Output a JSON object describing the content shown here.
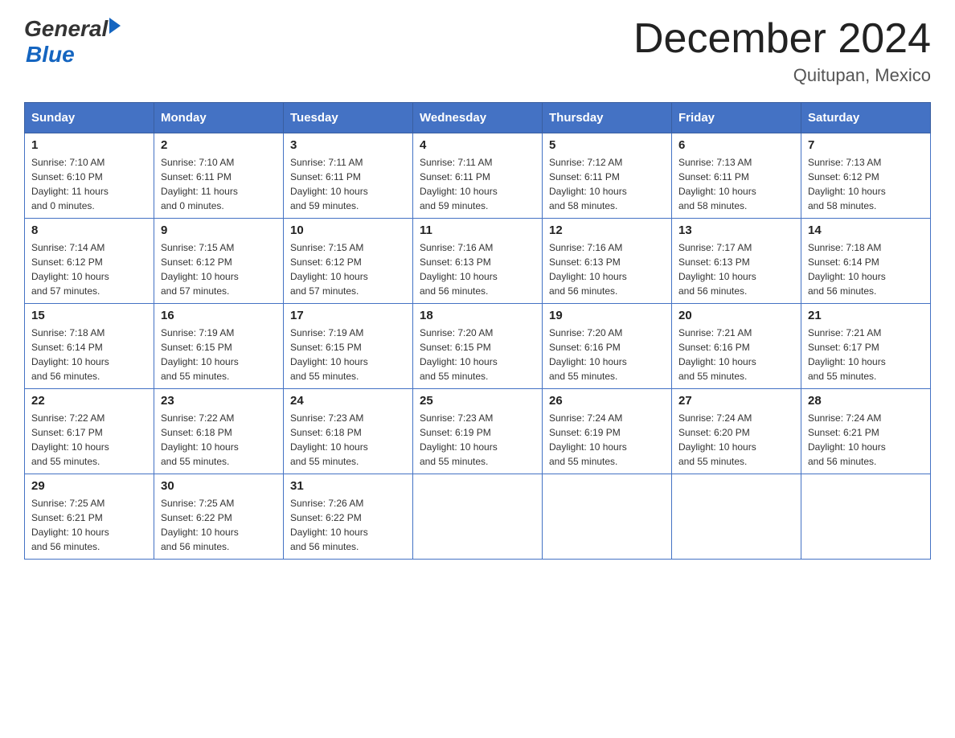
{
  "logo": {
    "general": "General",
    "blue": "Blue"
  },
  "header": {
    "title": "December 2024",
    "location": "Quitupan, Mexico"
  },
  "weekdays": [
    "Sunday",
    "Monday",
    "Tuesday",
    "Wednesday",
    "Thursday",
    "Friday",
    "Saturday"
  ],
  "weeks": [
    [
      {
        "day": "1",
        "sunrise": "7:10 AM",
        "sunset": "6:10 PM",
        "daylight": "11 hours and 0 minutes."
      },
      {
        "day": "2",
        "sunrise": "7:10 AM",
        "sunset": "6:11 PM",
        "daylight": "11 hours and 0 minutes."
      },
      {
        "day": "3",
        "sunrise": "7:11 AM",
        "sunset": "6:11 PM",
        "daylight": "10 hours and 59 minutes."
      },
      {
        "day": "4",
        "sunrise": "7:11 AM",
        "sunset": "6:11 PM",
        "daylight": "10 hours and 59 minutes."
      },
      {
        "day": "5",
        "sunrise": "7:12 AM",
        "sunset": "6:11 PM",
        "daylight": "10 hours and 58 minutes."
      },
      {
        "day": "6",
        "sunrise": "7:13 AM",
        "sunset": "6:11 PM",
        "daylight": "10 hours and 58 minutes."
      },
      {
        "day": "7",
        "sunrise": "7:13 AM",
        "sunset": "6:12 PM",
        "daylight": "10 hours and 58 minutes."
      }
    ],
    [
      {
        "day": "8",
        "sunrise": "7:14 AM",
        "sunset": "6:12 PM",
        "daylight": "10 hours and 57 minutes."
      },
      {
        "day": "9",
        "sunrise": "7:15 AM",
        "sunset": "6:12 PM",
        "daylight": "10 hours and 57 minutes."
      },
      {
        "day": "10",
        "sunrise": "7:15 AM",
        "sunset": "6:12 PM",
        "daylight": "10 hours and 57 minutes."
      },
      {
        "day": "11",
        "sunrise": "7:16 AM",
        "sunset": "6:13 PM",
        "daylight": "10 hours and 56 minutes."
      },
      {
        "day": "12",
        "sunrise": "7:16 AM",
        "sunset": "6:13 PM",
        "daylight": "10 hours and 56 minutes."
      },
      {
        "day": "13",
        "sunrise": "7:17 AM",
        "sunset": "6:13 PM",
        "daylight": "10 hours and 56 minutes."
      },
      {
        "day": "14",
        "sunrise": "7:18 AM",
        "sunset": "6:14 PM",
        "daylight": "10 hours and 56 minutes."
      }
    ],
    [
      {
        "day": "15",
        "sunrise": "7:18 AM",
        "sunset": "6:14 PM",
        "daylight": "10 hours and 56 minutes."
      },
      {
        "day": "16",
        "sunrise": "7:19 AM",
        "sunset": "6:15 PM",
        "daylight": "10 hours and 55 minutes."
      },
      {
        "day": "17",
        "sunrise": "7:19 AM",
        "sunset": "6:15 PM",
        "daylight": "10 hours and 55 minutes."
      },
      {
        "day": "18",
        "sunrise": "7:20 AM",
        "sunset": "6:15 PM",
        "daylight": "10 hours and 55 minutes."
      },
      {
        "day": "19",
        "sunrise": "7:20 AM",
        "sunset": "6:16 PM",
        "daylight": "10 hours and 55 minutes."
      },
      {
        "day": "20",
        "sunrise": "7:21 AM",
        "sunset": "6:16 PM",
        "daylight": "10 hours and 55 minutes."
      },
      {
        "day": "21",
        "sunrise": "7:21 AM",
        "sunset": "6:17 PM",
        "daylight": "10 hours and 55 minutes."
      }
    ],
    [
      {
        "day": "22",
        "sunrise": "7:22 AM",
        "sunset": "6:17 PM",
        "daylight": "10 hours and 55 minutes."
      },
      {
        "day": "23",
        "sunrise": "7:22 AM",
        "sunset": "6:18 PM",
        "daylight": "10 hours and 55 minutes."
      },
      {
        "day": "24",
        "sunrise": "7:23 AM",
        "sunset": "6:18 PM",
        "daylight": "10 hours and 55 minutes."
      },
      {
        "day": "25",
        "sunrise": "7:23 AM",
        "sunset": "6:19 PM",
        "daylight": "10 hours and 55 minutes."
      },
      {
        "day": "26",
        "sunrise": "7:24 AM",
        "sunset": "6:19 PM",
        "daylight": "10 hours and 55 minutes."
      },
      {
        "day": "27",
        "sunrise": "7:24 AM",
        "sunset": "6:20 PM",
        "daylight": "10 hours and 55 minutes."
      },
      {
        "day": "28",
        "sunrise": "7:24 AM",
        "sunset": "6:21 PM",
        "daylight": "10 hours and 56 minutes."
      }
    ],
    [
      {
        "day": "29",
        "sunrise": "7:25 AM",
        "sunset": "6:21 PM",
        "daylight": "10 hours and 56 minutes."
      },
      {
        "day": "30",
        "sunrise": "7:25 AM",
        "sunset": "6:22 PM",
        "daylight": "10 hours and 56 minutes."
      },
      {
        "day": "31",
        "sunrise": "7:26 AM",
        "sunset": "6:22 PM",
        "daylight": "10 hours and 56 minutes."
      },
      null,
      null,
      null,
      null
    ]
  ],
  "labels": {
    "sunrise": "Sunrise:",
    "sunset": "Sunset:",
    "daylight": "Daylight:"
  }
}
